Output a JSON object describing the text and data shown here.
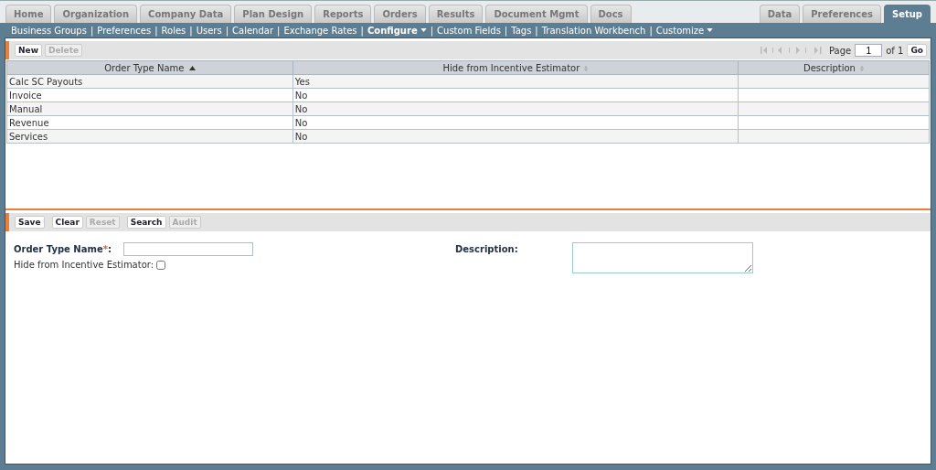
{
  "tabs_left": [
    {
      "label": "Home",
      "selected": false
    },
    {
      "label": "Organization",
      "selected": false
    },
    {
      "label": "Company Data",
      "selected": false
    },
    {
      "label": "Plan Design",
      "selected": false
    },
    {
      "label": "Reports",
      "selected": false
    },
    {
      "label": "Orders",
      "selected": false
    },
    {
      "label": "Results",
      "selected": false
    },
    {
      "label": "Document Mgmt",
      "selected": false
    },
    {
      "label": "Docs",
      "selected": false
    }
  ],
  "tabs_right": [
    {
      "label": "Data",
      "selected": false
    },
    {
      "label": "Preferences",
      "selected": false
    },
    {
      "label": "Setup",
      "selected": true
    }
  ],
  "subnav": [
    {
      "label": "Business Groups",
      "selected": false,
      "dropdown": false
    },
    {
      "label": "Preferences",
      "selected": false,
      "dropdown": false
    },
    {
      "label": "Roles",
      "selected": false,
      "dropdown": false
    },
    {
      "label": "Users",
      "selected": false,
      "dropdown": false
    },
    {
      "label": "Calendar",
      "selected": false,
      "dropdown": false
    },
    {
      "label": "Exchange Rates",
      "selected": false,
      "dropdown": false
    },
    {
      "label": "Configure",
      "selected": true,
      "dropdown": true
    },
    {
      "label": "Custom Fields",
      "selected": false,
      "dropdown": false
    },
    {
      "label": "Tags",
      "selected": false,
      "dropdown": false
    },
    {
      "label": "Translation Workbench",
      "selected": false,
      "dropdown": false
    },
    {
      "label": "Customize",
      "selected": false,
      "dropdown": true
    }
  ],
  "subnav_separator": "|",
  "list_toolbar": [
    {
      "label": "New",
      "disabled": false
    },
    {
      "label": "Delete",
      "disabled": true
    }
  ],
  "pager": {
    "label": "Page",
    "value": "1",
    "of": "of 1",
    "go": "Go"
  },
  "table": {
    "columns": [
      {
        "label": "Order Type Name",
        "sorted": true
      },
      {
        "label": "Hide from Incentive Estimator",
        "sorted": false
      },
      {
        "label": "Description",
        "sorted": false
      }
    ],
    "rows": [
      [
        "Calc SC Payouts",
        "Yes",
        ""
      ],
      [
        "Invoice",
        "No",
        ""
      ],
      [
        "Manual",
        "No",
        ""
      ],
      [
        "Revenue",
        "No",
        ""
      ],
      [
        "Services",
        "No",
        ""
      ]
    ]
  },
  "form_toolbar": [
    {
      "label": "Save",
      "disabled": false
    },
    {
      "label": "Clear",
      "disabled": false
    },
    {
      "label": "Reset",
      "disabled": true
    },
    {
      "label": "Search",
      "disabled": false
    },
    {
      "label": "Audit",
      "disabled": true
    }
  ],
  "form": {
    "name_field": {
      "label": "Order Type Name",
      "required": "*",
      "suffix": ":"
    },
    "hide_field": {
      "label": "Hide from Incentive Estimator:",
      "checked": false
    },
    "description_field": {
      "label": "Description",
      "suffix": ":"
    }
  }
}
